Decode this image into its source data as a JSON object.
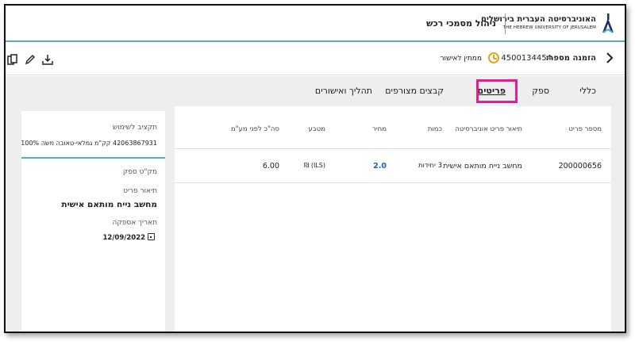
{
  "header": {
    "university_he": "האוניברסיטה העברית בירושלים",
    "university_en": "THE HEBREW UNIVERSITY OF JERUSALEM",
    "app_title": "ניהול מסמכי רכש"
  },
  "order": {
    "back_icon": "chevron-right-icon",
    "label": "הזמנה מספר:",
    "number": "4500134454",
    "status": "ממתין לאישור",
    "status_color": "#e8a31e",
    "actions": [
      "copy-icon",
      "edit-icon",
      "download-icon"
    ]
  },
  "tabs": [
    {
      "label": "כללי"
    },
    {
      "label": "ספק"
    },
    {
      "label": "פריטים",
      "active": true
    },
    {
      "label": "קבצים מצורפים"
    },
    {
      "label": "תהליך ואישורים"
    }
  ],
  "highlight_color": "#e0208c",
  "table": {
    "columns": [
      "מספר פריט",
      "תיאור פריט אוניברסיטה",
      "כמות",
      "מחיר",
      "מטבע",
      "סה\"כ לפני מע\"מ"
    ],
    "rows": [
      {
        "item_no": "200000656",
        "description": "מחשב נייח מותאם אישית",
        "quantity": "3 יחידות",
        "price": "2.0",
        "currency": "₪ (ILS)",
        "total": "6.00"
      }
    ]
  },
  "side": {
    "budget_label": "תקציב לשימוש",
    "budget_value": "42063867931  קק\"מ גמלאי-טאובה משה  100%",
    "supplier_sku_label": "מק\"ט ספק",
    "item_desc_label": "תיאור פריט",
    "item_desc_value": "מחשב נייח מותאם אישית",
    "supply_date_label": "תאריך אספקה",
    "supply_date_value": "12/09/2022"
  },
  "accent_color": "#4fb0c6"
}
